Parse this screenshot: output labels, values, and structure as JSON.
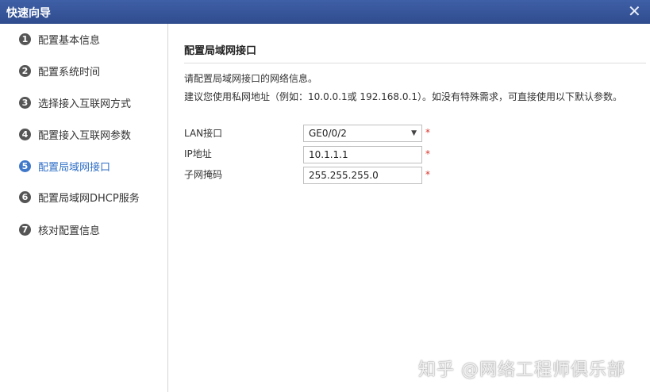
{
  "window": {
    "title": "快速向导"
  },
  "steps": [
    {
      "num": "1",
      "label": "配置基本信息"
    },
    {
      "num": "2",
      "label": "配置系统时间"
    },
    {
      "num": "3",
      "label": "选择接入互联网方式"
    },
    {
      "num": "4",
      "label": "配置接入互联网参数"
    },
    {
      "num": "5",
      "label": "配置局域网接口"
    },
    {
      "num": "6",
      "label": "配置局域网DHCP服务"
    },
    {
      "num": "7",
      "label": "核对配置信息"
    }
  ],
  "active_step": 5,
  "content": {
    "title": "配置局域网接口",
    "desc1": "请配置局域网接口的网络信息。",
    "desc2": "建议您使用私网地址（例如：10.0.0.1或 192.168.0.1）。如没有特殊需求，可直接使用以下默认参数。"
  },
  "form": {
    "lan_label": "LAN接口",
    "lan_value": "GE0/0/2",
    "ip_label": "IP地址",
    "ip_value": "10.1.1.1",
    "mask_label": "子网掩码",
    "mask_value": "255.255.255.0",
    "required_mark": "*"
  },
  "watermark": "知乎 @网络工程师俱乐部",
  "icons": {
    "close": "close-icon",
    "dropdown": "chevron-down-icon"
  },
  "colors": {
    "titlebar": "#2f4c8e",
    "active": "#3f78c9",
    "required": "#d9342b"
  }
}
